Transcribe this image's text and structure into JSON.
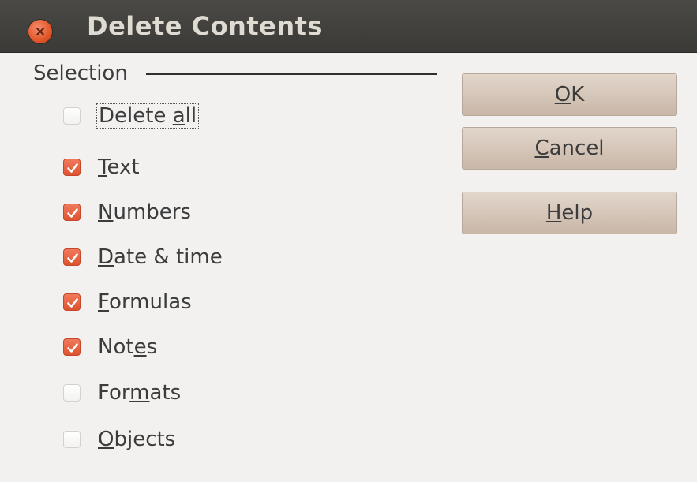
{
  "window": {
    "title": "Delete Contents"
  },
  "selection": {
    "heading": "Selection",
    "options": [
      {
        "pre": "Delete ",
        "u": "a",
        "post": "ll",
        "checked": false
      },
      {
        "pre": "",
        "u": "T",
        "post": "ext",
        "checked": true
      },
      {
        "pre": "",
        "u": "N",
        "post": "umbers",
        "checked": true
      },
      {
        "pre": "",
        "u": "D",
        "post": "ate & time",
        "checked": true
      },
      {
        "pre": "",
        "u": "F",
        "post": "ormulas",
        "checked": true
      },
      {
        "pre": "Not",
        "u": "e",
        "post": "s",
        "checked": true
      },
      {
        "pre": "For",
        "u": "m",
        "post": "ats",
        "checked": false
      },
      {
        "pre": "",
        "u": "O",
        "post": "bjects",
        "checked": false
      }
    ]
  },
  "buttons": {
    "ok": {
      "pre": "",
      "u": "O",
      "post": "K"
    },
    "cancel": {
      "pre": "",
      "u": "C",
      "post": "ancel"
    },
    "help": {
      "pre": "",
      "u": "H",
      "post": "elp"
    }
  },
  "colors": {
    "titlebar": "#3b3a36",
    "accent": "#de5230",
    "button": "#d5c5b8"
  }
}
